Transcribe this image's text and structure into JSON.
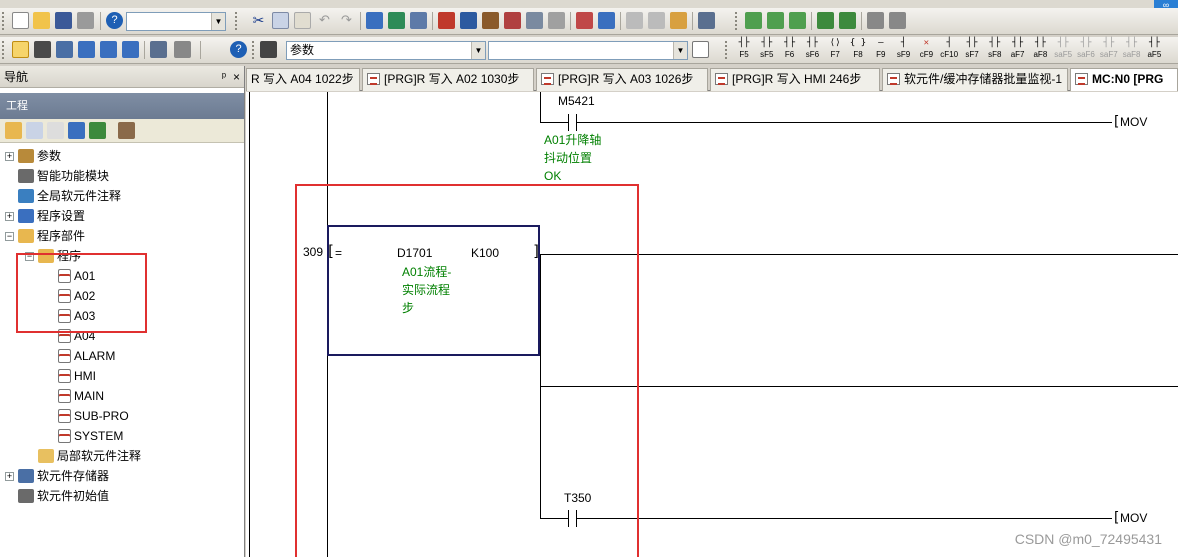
{
  "toolbar1": {
    "combo_value": ""
  },
  "toolbar2": {
    "param_combo": "参数",
    "second_combo": ""
  },
  "fkeys": [
    "F5",
    "sF5",
    "F6",
    "sF6",
    "F7",
    "F8",
    "F9",
    "sF9",
    "cF9",
    "cF10",
    "sF7",
    "sF8",
    "aF7",
    "aF8",
    "saF5",
    "saF6",
    "saF7",
    "saF8",
    "aF5"
  ],
  "nav": {
    "title": "导航",
    "pin": "ᵖ",
    "close": "×",
    "project_label": "工程"
  },
  "tree": [
    {
      "label": "参数",
      "expander": "+"
    },
    {
      "label": "智能功能模块",
      "expander": ""
    },
    {
      "label": "全局软元件注释",
      "expander": ""
    },
    {
      "label": "程序设置",
      "expander": "+"
    },
    {
      "label": "程序部件",
      "expander": "−"
    },
    {
      "label": "程序",
      "expander": "−"
    },
    {
      "label": "A01"
    },
    {
      "label": "A02"
    },
    {
      "label": "A03"
    },
    {
      "label": "A04"
    },
    {
      "label": "ALARM"
    },
    {
      "label": "HMI"
    },
    {
      "label": "MAIN"
    },
    {
      "label": "SUB-PRO"
    },
    {
      "label": "SYSTEM"
    },
    {
      "label": "局部软元件注释"
    },
    {
      "label": "软元件存储器",
      "expander": "+"
    },
    {
      "label": "软元件初始值"
    }
  ],
  "tabs": [
    {
      "label": "R 写入 A04 1022步"
    },
    {
      "label": "[PRG]R 写入 A02 1030步"
    },
    {
      "label": "[PRG]R 写入 A03 1026步"
    },
    {
      "label": "[PRG]R 写入 HMI 246步"
    },
    {
      "label": "软元件/缓冲存储器批量监视-1"
    },
    {
      "label": "MC:N0 [PRG"
    }
  ],
  "ladder": {
    "contact1_device": "M5421",
    "contact1_comment": [
      "A01升降轴",
      "抖动位置",
      "OK"
    ],
    "coil1_instr": "MOV",
    "step_number": "309",
    "compare_op": "=",
    "compare_dev1": "D1701",
    "compare_dev2": "K100",
    "compare_comment": [
      "A01流程-",
      "实际流程",
      "步"
    ],
    "contact2_device": "T350",
    "coil2_instr": "MOV"
  },
  "watermark": "CSDN @m0_72495431",
  "colors": {
    "highlight_box": "#e03030",
    "comment": "#008000",
    "instr_box": "#1a1a5e"
  }
}
